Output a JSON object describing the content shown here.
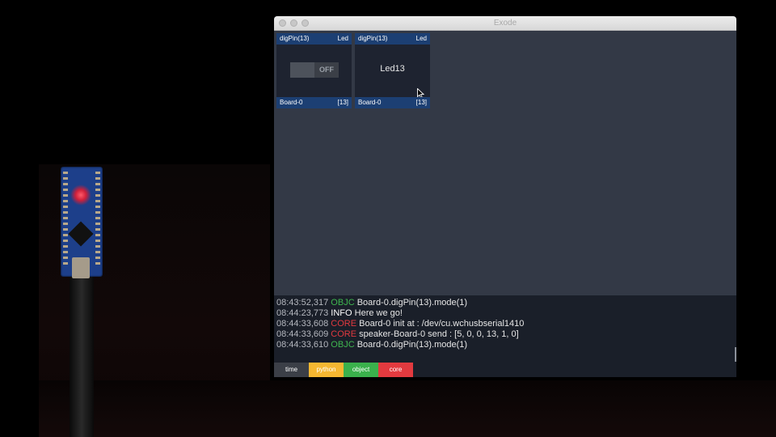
{
  "window": {
    "title": "Exode"
  },
  "cards": [
    {
      "head_left": "digPin(13)",
      "head_right": "Led",
      "foot_left": "Board-0",
      "foot_right": "[13]",
      "toggle_text": "OFF"
    },
    {
      "head_left": "digPin(13)",
      "head_right": "Led",
      "foot_left": "Board-0",
      "foot_right": "[13]",
      "label": "Led13"
    }
  ],
  "log": [
    {
      "time": "08:43:52,317",
      "tag": "OBJC",
      "message": "Board-0.digPin(13).mode(1)"
    },
    {
      "time": "08:44:23,773",
      "tag": "INFO",
      "message": "Here we go!"
    },
    {
      "time": "08:44:33,608",
      "tag": "CORE",
      "message": "Board-0 init at : /dev/cu.wchusbserial1410"
    },
    {
      "time": "08:44:33,609",
      "tag": "CORE",
      "message": "speaker-Board-0 send  : [5, 0, 0, 13, 1, 0]"
    },
    {
      "time": "08:44:33,610",
      "tag": "OBJC",
      "message": "Board-0.digPin(13).mode(1)"
    }
  ],
  "tabs": [
    {
      "label": "time",
      "color": "#3b3f47"
    },
    {
      "label": "python",
      "color": "#f5b731"
    },
    {
      "label": "object",
      "color": "#3ab14c"
    },
    {
      "label": "core",
      "color": "#e23a3f"
    }
  ],
  "colors": {
    "card_header": "#1c3f73",
    "panel_bg": "#333946",
    "console_bg": "#1a1f29"
  }
}
